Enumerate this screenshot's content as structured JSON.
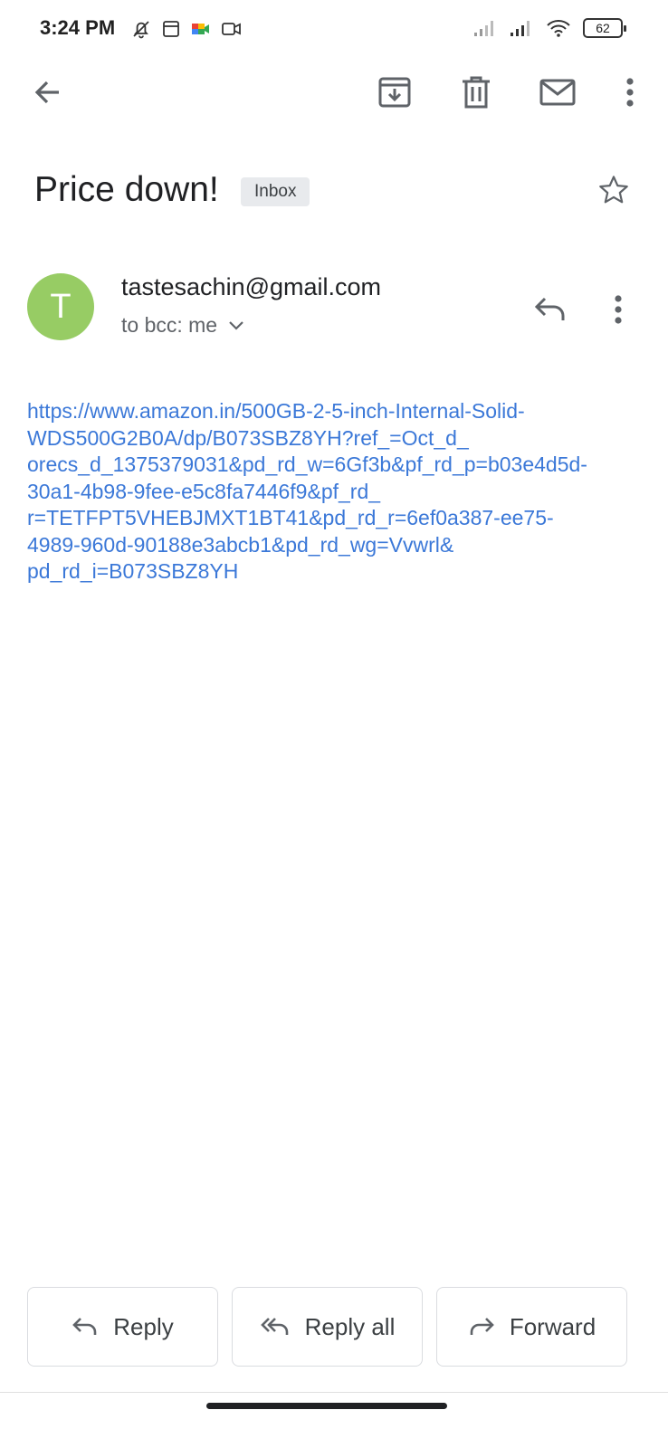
{
  "status_bar": {
    "time": "3:24 PM",
    "battery": "62"
  },
  "app_bar": {
    "icons": [
      "back-arrow-icon",
      "archive-icon",
      "trash-icon",
      "mail-icon",
      "more-vert-icon"
    ]
  },
  "email": {
    "subject": "Price down!",
    "label": "Inbox",
    "sender": {
      "initial": "T",
      "avatar_color": "#97cc64",
      "email": "tastesachin@gmail.com",
      "recipient_line": "to bcc: me"
    },
    "body_lines": [
      "https://www.amazon.in/500GB-2-5-inch-Internal-Solid-",
      "WDS500G2B0A/dp/B073SBZ8YH?ref_=Oct_d_",
      "orecs_d_1375379031&pd_rd_w=6Gf3b&pf_rd_p=b03e4d5d-",
      "30a1-4b98-9fee-e5c8fa7446f9&pf_rd_",
      "r=TETFPT5VHEBJMXT1BT41&pd_rd_r=6ef0a387-ee75-",
      "4989-960d-90188e3abcb1&pd_rd_wg=Vvwrl&",
      "pd_rd_i=B073SBZ8YH"
    ],
    "link_color": "#3b78d8"
  },
  "actions": {
    "reply": "Reply",
    "reply_all": "Reply all",
    "forward": "Forward"
  }
}
